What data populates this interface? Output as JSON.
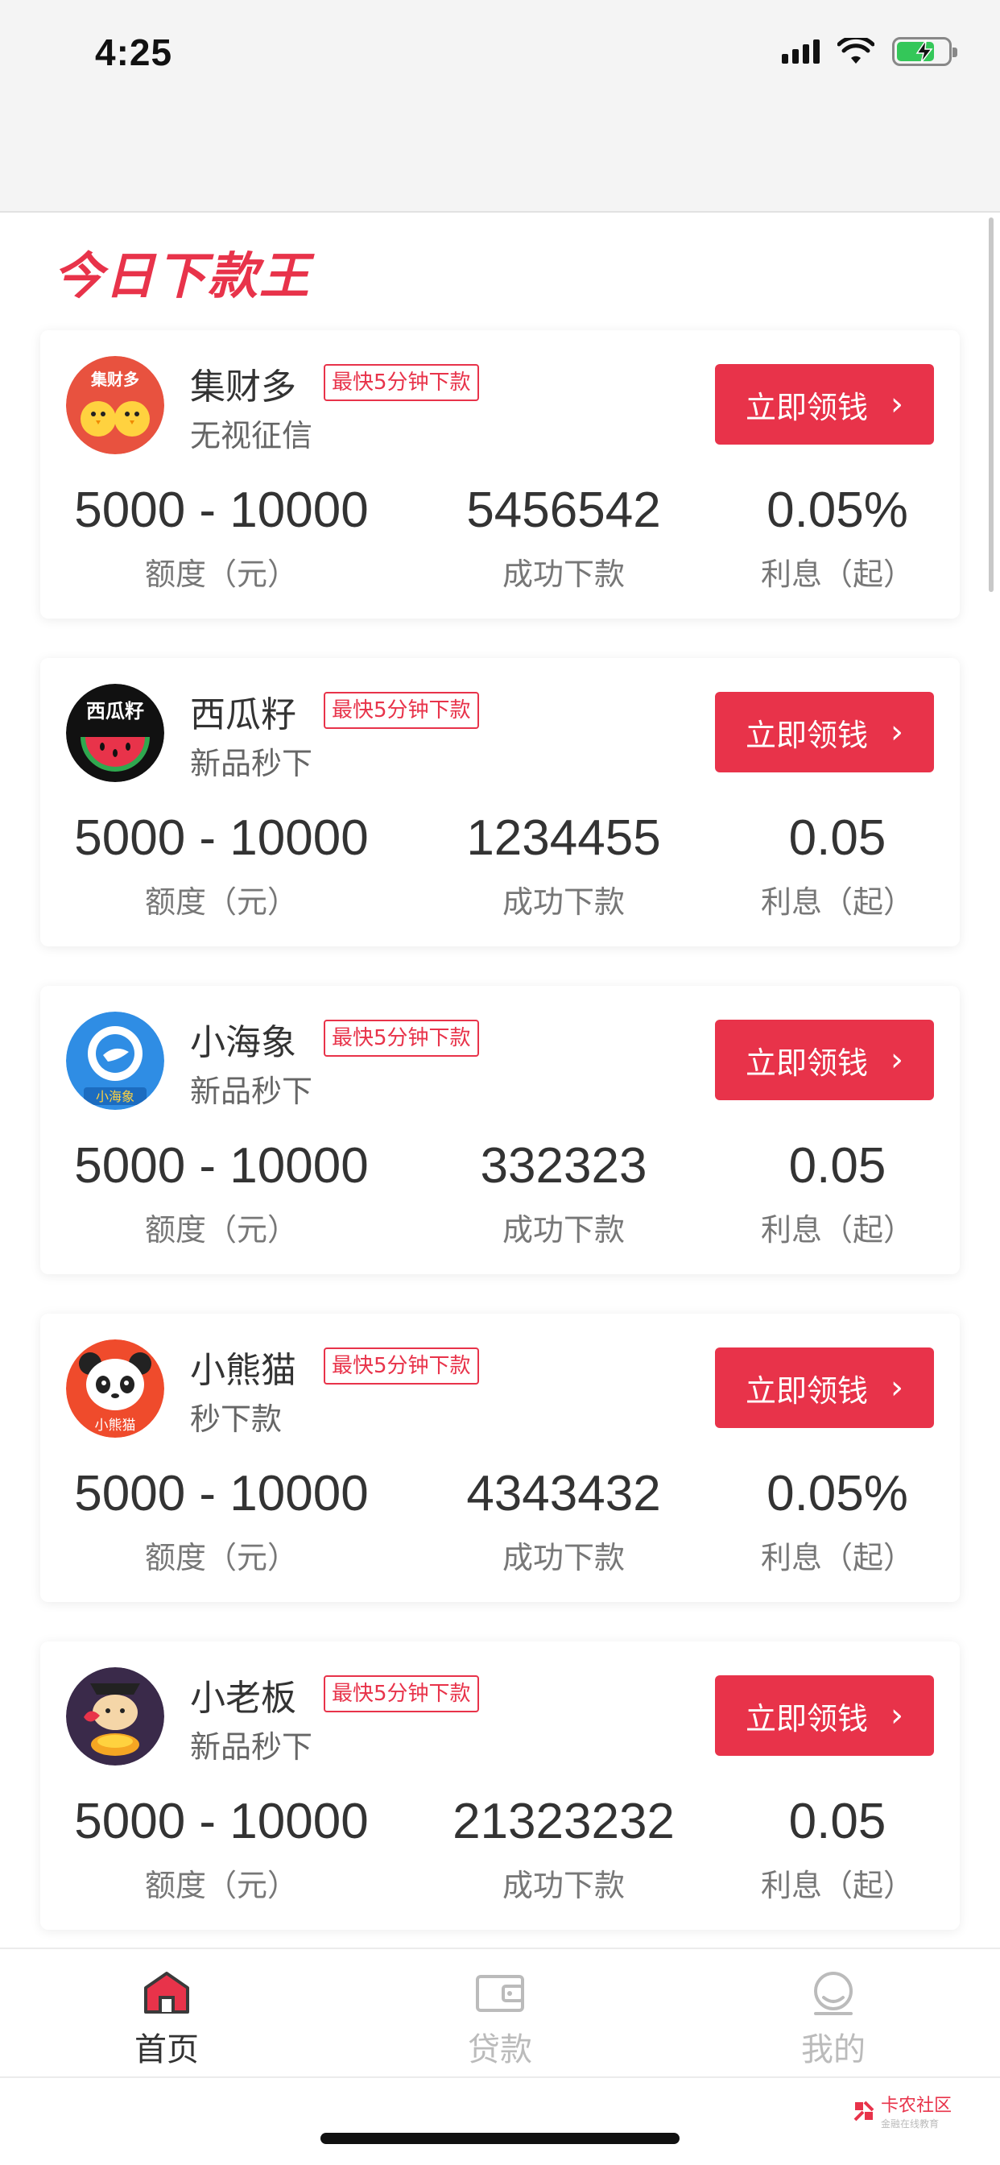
{
  "status_bar": {
    "time": "4:25"
  },
  "brand_title": "今日下款王",
  "colors": {
    "accent": "#e8334a",
    "battery": "#34c759"
  },
  "cards": [
    {
      "name": "集财多",
      "tag": "最快5分钟下款",
      "subtitle": "无视征信",
      "logo_text": "集财多",
      "logo_icon": "chick-logo",
      "button_label": "立即领钱",
      "amount": "5000 - 10000",
      "amount_label": "额度（元）",
      "loans": "5456542",
      "loans_label": "成功下款",
      "rate": "0.05%",
      "rate_label": "利息（起）"
    },
    {
      "name": "西瓜籽",
      "tag": "最快5分钟下款",
      "subtitle": "新品秒下",
      "logo_text": "西瓜籽",
      "logo_icon": "watermelon-logo",
      "button_label": "立即领钱",
      "amount": "5000 - 10000",
      "amount_label": "额度（元）",
      "loans": "1234455",
      "loans_label": "成功下款",
      "rate": "0.05",
      "rate_label": "利息（起）"
    },
    {
      "name": "小海象",
      "tag": "最快5分钟下款",
      "subtitle": "新品秒下",
      "logo_text": "小海象",
      "logo_icon": "walrus-logo",
      "button_label": "立即领钱",
      "amount": "5000 - 10000",
      "amount_label": "额度（元）",
      "loans": "332323",
      "loans_label": "成功下款",
      "rate": "0.05",
      "rate_label": "利息（起）"
    },
    {
      "name": "小熊猫",
      "tag": "最快5分钟下款",
      "subtitle": "秒下款",
      "logo_text": "小熊猫",
      "logo_icon": "panda-logo",
      "button_label": "立即领钱",
      "amount": "5000 - 10000",
      "amount_label": "额度（元）",
      "loans": "4343432",
      "loans_label": "成功下款",
      "rate": "0.05%",
      "rate_label": "利息（起）"
    },
    {
      "name": "小老板",
      "tag": "最快5分钟下款",
      "subtitle": "新品秒下",
      "logo_text": "",
      "logo_icon": "cat-boss-logo",
      "button_label": "立即领钱",
      "amount": "5000 - 10000",
      "amount_label": "额度（元）",
      "loans": "21323232",
      "loans_label": "成功下款",
      "rate": "0.05",
      "rate_label": "利息（起）"
    }
  ],
  "tabbar": {
    "items": [
      {
        "label": "首页",
        "icon": "home-icon",
        "active": true
      },
      {
        "label": "贷款",
        "icon": "wallet-icon",
        "active": false
      },
      {
        "label": "我的",
        "icon": "profile-icon",
        "active": false
      }
    ]
  },
  "watermark": {
    "text": "卡农社区",
    "sub": "金融在线教育"
  }
}
